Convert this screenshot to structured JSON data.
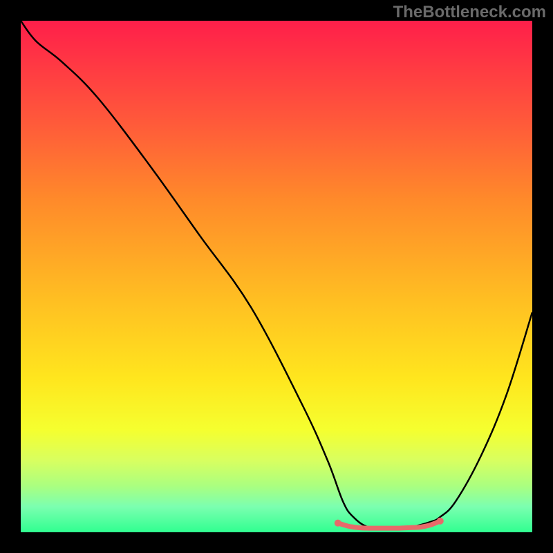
{
  "watermark": "TheBottleneck.com",
  "chart_data": {
    "type": "line",
    "title": "",
    "xlabel": "",
    "ylabel": "",
    "xlim": [
      0,
      100
    ],
    "ylim": [
      0,
      100
    ],
    "grid": false,
    "legend": false,
    "background_gradient": {
      "top_color": "#ff1f4a",
      "mid_color": "#ffe61e",
      "bottom_color": "#30ff90"
    },
    "series": [
      {
        "name": "bottleneck-curve",
        "color": "#000000",
        "x": [
          0,
          3,
          8,
          15,
          25,
          35,
          45,
          55,
          60,
          63,
          65,
          68,
          72,
          76,
          80,
          82,
          85,
          90,
          95,
          100
        ],
        "y": [
          100,
          96,
          92,
          85,
          72,
          58,
          44,
          25,
          14,
          6,
          3,
          1,
          1,
          1,
          2,
          3,
          6,
          15,
          27,
          43
        ]
      },
      {
        "name": "optimal-range-marker",
        "color": "#e76a6a",
        "x": [
          62,
          64,
          66,
          68,
          70,
          72,
          74,
          76,
          78,
          80,
          82
        ],
        "y": [
          1.8,
          1.2,
          0.9,
          0.8,
          0.8,
          0.8,
          0.8,
          0.9,
          1.0,
          1.4,
          2.2
        ]
      }
    ],
    "annotations": [],
    "optimal_range": {
      "start_pct": 62,
      "end_pct": 82
    }
  }
}
